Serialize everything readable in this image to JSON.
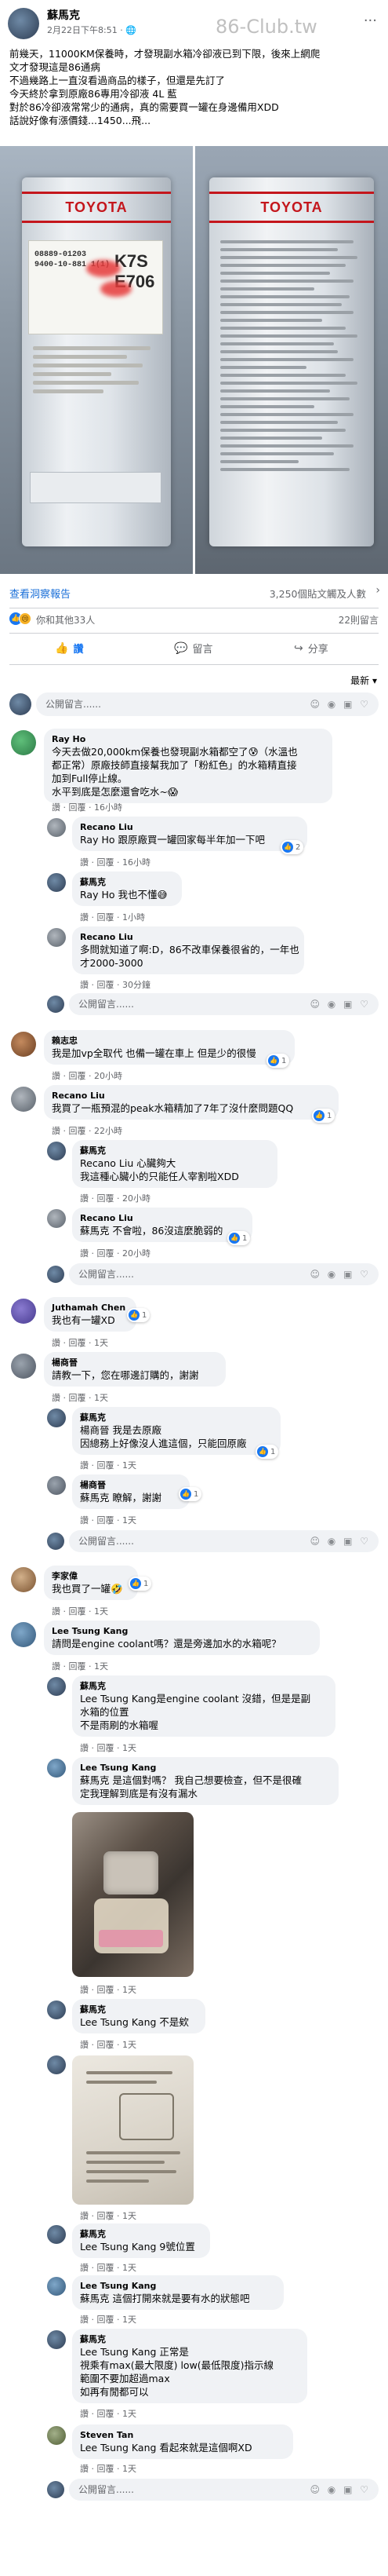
{
  "post": {
    "author": "蘇馬克",
    "time": "2月22日下午8:51 · ",
    "privacy_icon": "globe-icon",
    "watermark": "86-Club.tw",
    "text_lines": [
      "前幾天，11000KM保養時，才發現副水箱冷卻液已到下限，後來上網爬",
      "文才發現這是86通病",
      "不過幾路上一直沒看過商品的樣子，但還是先訂了",
      "今天終於拿到原廠86專用冷卻液 4L 藍",
      "對於86冷卻液常常少的通病，真的需要買一罐在身邊備用XDD",
      "話說好像有漲價錢...1450...飛..."
    ],
    "photo_labels": {
      "brand": "TOYOTA",
      "code_top": "K7S",
      "code_bottom": "E706",
      "part_no": "08889-01203\n9400-10-881 1(1)"
    }
  },
  "insights": {
    "link": "查看洞察報告",
    "stat": "3,250個貼文觸及人數",
    "chevron_icon": "chevron-right-icon"
  },
  "reactions": {
    "text": "你和其他33人",
    "comments": "22則留言"
  },
  "actions": {
    "like": "讚",
    "comment": "留言",
    "share": "分享"
  },
  "sort_label": "最新 ▾",
  "comment_placeholder": "公開留言......",
  "comments": [
    {
      "author": "Ray Ho",
      "lines": [
        "今天去做20,000km保養也發現副水箱都空了😰（水溫也",
        "都正常）原廠技師直接幫我加了「粉紅色」的水箱精直接",
        "加到Full停止線。",
        "水平到底是怎麼還會吃水~😱"
      ],
      "meta": "讚 · 回覆 · 16小時"
    },
    {
      "author": "Recano Liu",
      "lines": [
        "Ray Ho 跟原廠買一罐回家每半年加一下吧"
      ],
      "meta": "讚 · 回覆 · 16小時",
      "likes": "2"
    },
    {
      "author": "蘇馬克",
      "lines": [
        "Ray Ho 我也不懂😅"
      ],
      "meta": "讚 · 回覆 · 1小時"
    },
    {
      "author": "Recano Liu",
      "lines": [
        "多問就知道了啊:D，86不改車保養很省的，一年也",
        "才2000-3000"
      ],
      "meta": "讚 · 回覆 · 30分鐘"
    },
    {
      "author": "賴志忠",
      "lines": [
        "我是加vp全取代 也備一罐在車上 但是少的很慢"
      ],
      "meta": "讚 · 回覆 · 20小時",
      "likes": "1"
    },
    {
      "author": "Recano Liu",
      "lines": [
        "我買了一瓶預混的peak水箱精加了7年了沒什麼問題QQ"
      ],
      "meta": "讚 · 回覆 · 22小時",
      "likes": "1"
    },
    {
      "author": "蘇馬克",
      "lines": [
        "Recano Liu 心臟夠大",
        "我這種心臟小的只能任人宰割啦XDD"
      ],
      "meta": "讚 · 回覆 · 20小時"
    },
    {
      "author": "Recano Liu",
      "lines": [
        "蘇馬克 不會啦，86沒這麼脆弱的"
      ],
      "meta": "讚 · 回覆 · 20小時",
      "likes": "1"
    },
    {
      "author": "Juthamah Chen",
      "lines": [
        "我也有一罐XD"
      ],
      "meta": "讚 · 回覆 · 1天",
      "likes": "1"
    },
    {
      "author": "楊商晉",
      "lines": [
        "請教一下，您在哪邊訂購的，謝謝"
      ],
      "meta": "讚 · 回覆 · 1天"
    },
    {
      "author": "蘇馬克",
      "lines": [
        "楊商晉 我是去原廠",
        "因總務上好像沒人進這個，只能回原廠"
      ],
      "meta": "讚 · 回覆 · 1天",
      "likes": "1"
    },
    {
      "author": "楊商晉",
      "lines": [
        "蘇馬克 瞭解，謝謝"
      ],
      "meta": "讚 · 回覆 · 1天",
      "likes": "1"
    },
    {
      "author": "李家偉",
      "lines": [
        "我也買了一罐🤣"
      ],
      "meta": "讚 · 回覆 · 1天",
      "likes": "1"
    },
    {
      "author": "Lee Tsung Kang",
      "lines": [
        "請問是engine coolant嗎？還是旁邊加水的水箱呢？"
      ],
      "meta": "讚 · 回覆 · 1天"
    },
    {
      "author": "蘇馬克",
      "lines": [
        "Lee Tsung Kang是engine coolant 沒錯，但是是副",
        "水箱的位置",
        "不是雨刷的水箱喔"
      ],
      "meta": "讚 · 回覆 · 1天"
    },
    {
      "author": "Lee Tsung Kang",
      "lines": [
        "蘇馬克 是這個對嗎？ 我自己想要檢查，但不是很確",
        "定我理解到底是有沒有漏水"
      ],
      "meta": "讚 · 回覆 · 1天"
    },
    {
      "author": "蘇馬克",
      "lines": [
        "Lee Tsung Kang 不是欸"
      ],
      "meta": "讚 · 回覆 · 1天"
    },
    {
      "author": "蘇馬克",
      "lines": [
        "Lee Tsung Kang 9號位置"
      ],
      "meta": "讚 · 回覆 · 1天"
    },
    {
      "author": "Lee Tsung Kang",
      "lines": [
        "蘇馬克 這個打開來就是要有水的狀態吧"
      ],
      "meta": "讚 · 回覆 · 1天"
    },
    {
      "author": "蘇馬克",
      "lines": [
        "Lee Tsung Kang 正常是",
        "視乘有max(最大限度) low(最低限度)指示線",
        "範圍不要加超過max",
        "如再有閒都可以"
      ],
      "meta": "讚 · 回覆 · 1天"
    },
    {
      "author": "Steven Tan",
      "lines": [
        "Lee Tsung Kang 看起來就是這個啊XD"
      ],
      "meta": "讚 · 回覆 · 1天"
    }
  ],
  "colors": {
    "accent": "#1877f2",
    "bubble": "#f0f2f5",
    "muted": "#65676b",
    "brand_red": "#c4161c"
  }
}
